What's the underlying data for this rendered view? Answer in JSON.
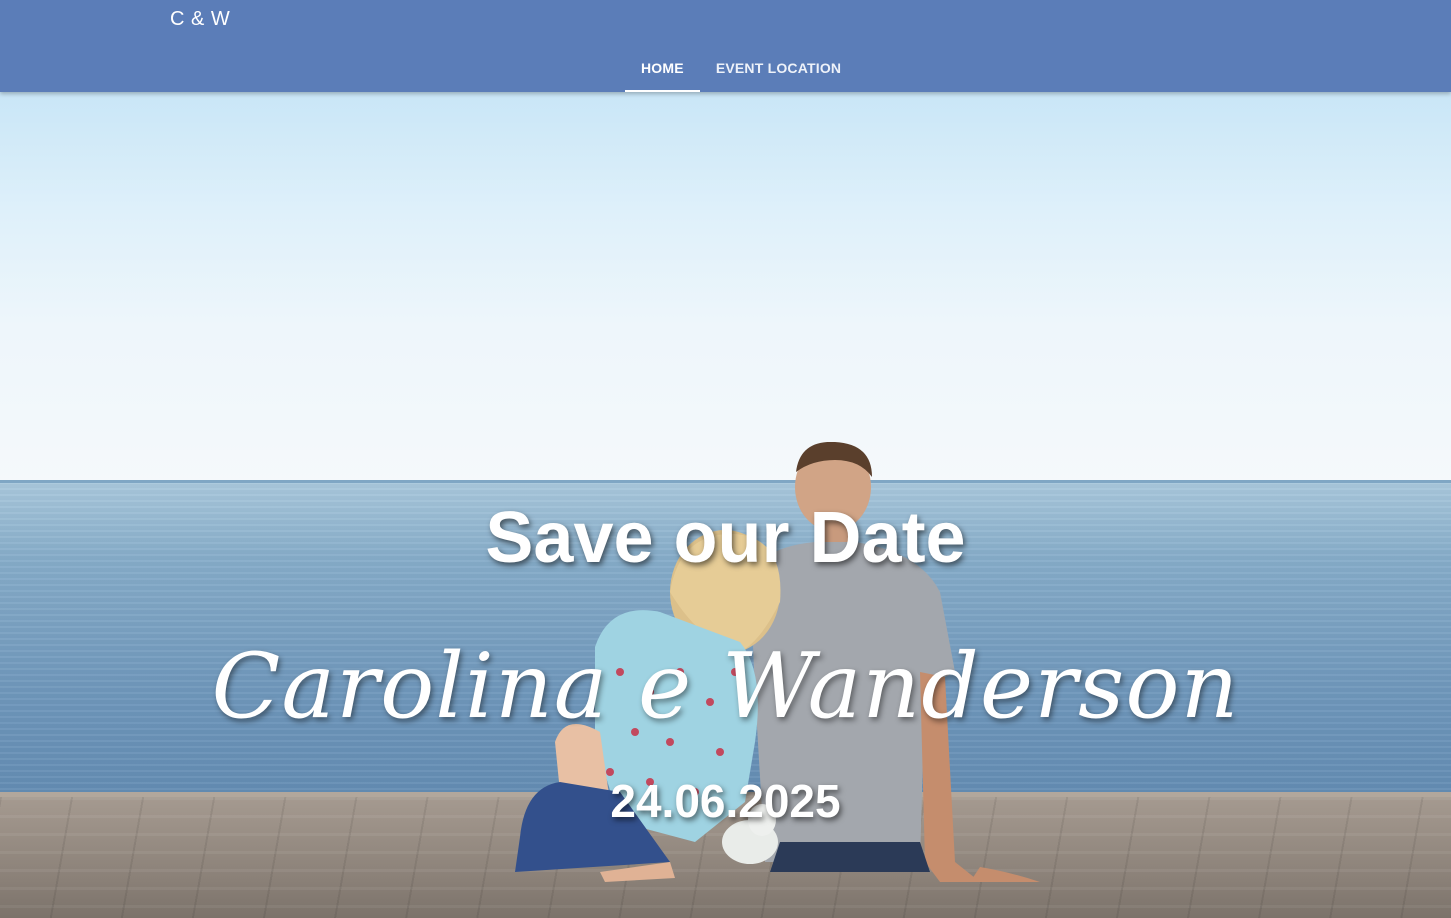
{
  "navbar": {
    "brand": "C & W",
    "tabs": [
      {
        "label": "HOME",
        "active": true
      },
      {
        "label": "EVENT LOCATION",
        "active": false
      }
    ],
    "background_color": "#5b7db8"
  },
  "hero": {
    "headline": "Save our Date",
    "names": "Carolina e Wanderson",
    "date": "24.06.2025",
    "background_image": "couple-sitting-on-pier-by-sea"
  }
}
